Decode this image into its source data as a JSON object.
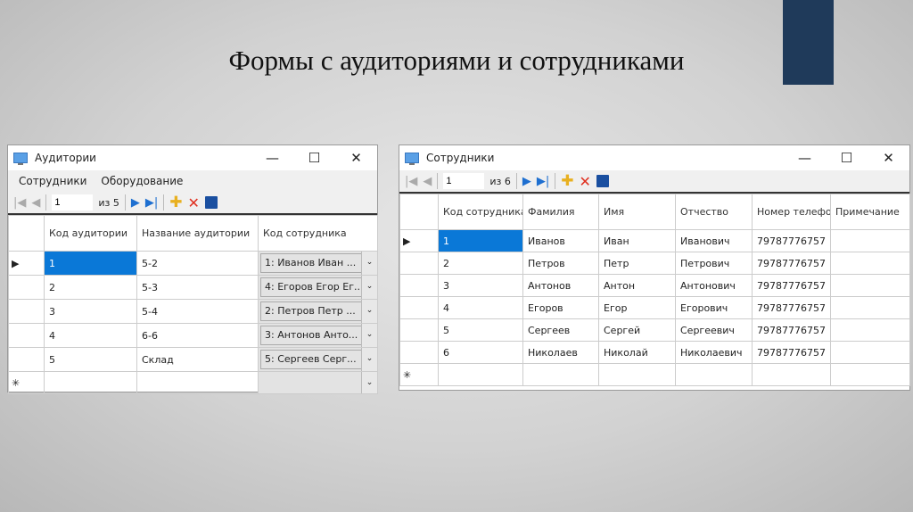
{
  "slide": {
    "title": "Формы с аудиториями и сотрудниками",
    "accent": "#1f3a5a"
  },
  "left": {
    "title": "Аудитории",
    "menu": [
      "Сотрудники",
      "Оборудование"
    ],
    "nav": {
      "position": "1",
      "of": "из 5"
    },
    "columns": [
      "Код аудитории",
      "Название аудитории",
      "Код сотрудника"
    ],
    "rows": [
      [
        "1",
        "5-2",
        "1: Иванов Иван ..."
      ],
      [
        "2",
        "5-3",
        "4: Егоров Егор Ег..."
      ],
      [
        "3",
        "5-4",
        "2: Петров Петр ..."
      ],
      [
        "4",
        "6-6",
        "3: Антонов Анто..."
      ],
      [
        "5",
        "Склад",
        "5: Сергеев Серг..."
      ]
    ]
  },
  "right": {
    "title": "Сотрудники",
    "nav": {
      "position": "1",
      "of": "из 6"
    },
    "columns": [
      "Код сотрудника",
      "Фамилия",
      "Имя",
      "Отчество",
      "Номер телефона",
      "Примечание"
    ],
    "rows": [
      [
        "1",
        "Иванов",
        "Иван",
        "Иванович",
        "79787776757",
        ""
      ],
      [
        "2",
        "Петров",
        "Петр",
        "Петрович",
        "79787776757",
        ""
      ],
      [
        "3",
        "Антонов",
        "Антон",
        "Антонович",
        "79787776757",
        ""
      ],
      [
        "4",
        "Егоров",
        "Егор",
        "Егорович",
        "79787776757",
        ""
      ],
      [
        "5",
        "Сергеев",
        "Сергей",
        "Сергеевич",
        "79787776757",
        ""
      ],
      [
        "6",
        "Николаев",
        "Николай",
        "Николаевич",
        "79787776757",
        ""
      ]
    ]
  },
  "glyphs": {
    "current": "▶",
    "new": "✳",
    "min": "—",
    "max": "☐",
    "close": "✕",
    "dd": "⌄"
  }
}
